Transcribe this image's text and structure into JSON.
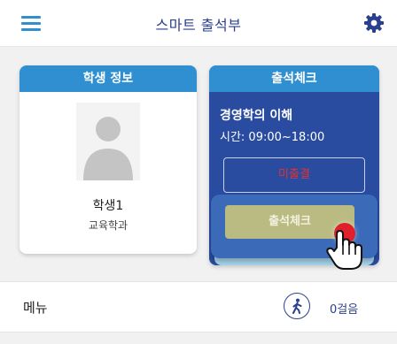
{
  "colors": {
    "accent": "#2f8fd0",
    "navy": "#2b3f8f",
    "card_blue": "#2a4ca0",
    "alert_red": "#e2322f",
    "button_olive": "#b9bb82"
  },
  "header": {
    "title": "스마트 출석부",
    "menu_icon": "hamburger-icon",
    "settings_icon": "gear-icon"
  },
  "student": {
    "header": "학생 정보",
    "name": "학생1",
    "department": "교육학과",
    "avatar_icon": "user-silhouette-icon"
  },
  "attendance": {
    "header": "출석체크",
    "course": "경영학의 이해",
    "time": "시간: 09:00~18:00",
    "status": "미출결",
    "button_label": "출석체크"
  },
  "menu": {
    "label": "메뉴",
    "walk_icon": "walking-person-icon",
    "steps": "0걸음"
  }
}
